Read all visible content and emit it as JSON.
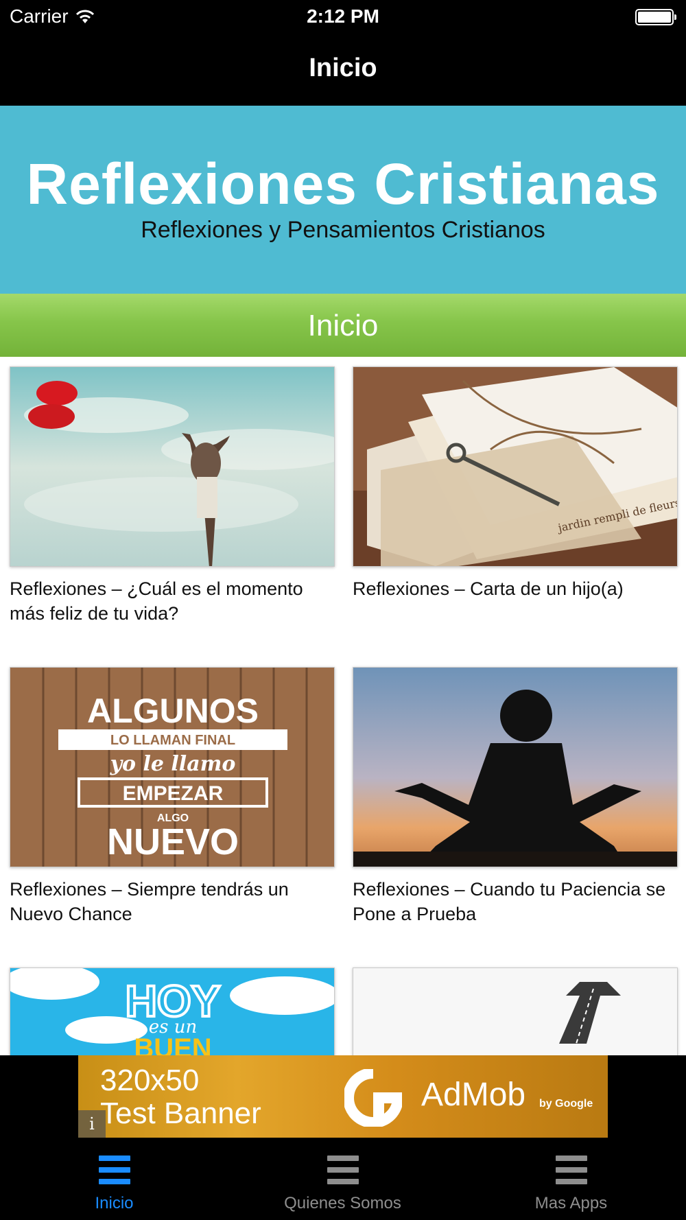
{
  "status": {
    "carrier": "Carrier",
    "time": "2:12 PM"
  },
  "nav": {
    "title": "Inicio"
  },
  "hero": {
    "title": "Reflexiones Cristianas",
    "subtitle": "Reflexiones y Pensamientos Cristianos"
  },
  "section": {
    "label": "Inicio"
  },
  "articles": [
    {
      "caption": "Reflexiones – ¿Cuál es el momento más feliz de tu vida?"
    },
    {
      "caption": "Reflexiones – Carta de un hijo(a)",
      "image_text": "jardin rempli de fleurs."
    },
    {
      "caption": "Reflexiones – Siempre tendrás un Nuevo Chance",
      "image_text": {
        "l1": "ALGUNOS",
        "l2": "LO LLAMAN FINAL",
        "l3": "yo le llamo",
        "l4": "EMPEZAR",
        "l5": "ALGO",
        "l6": "NUEVO"
      }
    },
    {
      "caption": "Reflexiones – Cuando tu Paciencia se Pone a Prueba"
    },
    {
      "caption": "",
      "image_text": {
        "l1": "HOY",
        "l2": "es un",
        "l3": "BUEN"
      }
    },
    {
      "caption": ""
    }
  ],
  "ad": {
    "line1": "320x50",
    "line2": "Test Banner",
    "brand": "AdMob",
    "by": "by Google",
    "info": "i"
  },
  "tabs": [
    {
      "label": "Inicio",
      "active": true
    },
    {
      "label": "Quienes Somos",
      "active": false
    },
    {
      "label": "Mas Apps",
      "active": false
    }
  ],
  "colors": {
    "accent": "#1a8cff",
    "inactive": "#8e8e8e",
    "hero": "#4fbbd2",
    "section": "#86c54a"
  }
}
